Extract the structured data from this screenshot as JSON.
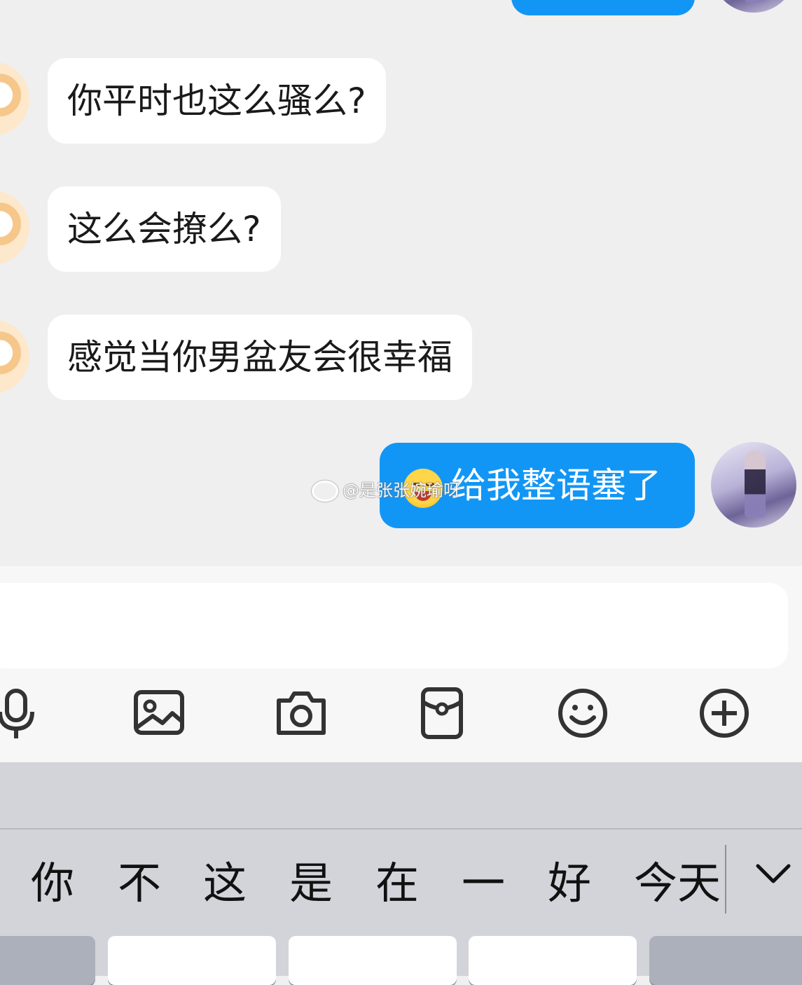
{
  "messages": [
    {
      "side": "in",
      "text": "你平时也这么骚么?"
    },
    {
      "side": "in",
      "text": "这么会撩么?"
    },
    {
      "side": "in",
      "text": "感觉当你男盆友会很幸福"
    },
    {
      "side": "out",
      "text": "给我整语塞了",
      "emoji": "laughing-face-emoji"
    }
  ],
  "watermark": "@是张张婉瑜呀",
  "input": {
    "placeholder": ""
  },
  "toolbar": {
    "icons": [
      "microphone-icon",
      "image-icon",
      "camera-icon",
      "red-packet-icon",
      "emoji-icon",
      "add-icon"
    ]
  },
  "keyboard": {
    "candidates": [
      "你",
      "不",
      "这",
      "是",
      "在",
      "一",
      "好",
      "今天"
    ],
    "expand_icon": "chevron-down-icon"
  },
  "colors": {
    "background": "#efefef",
    "outgoing_bubble": "#1296f5",
    "incoming_bubble": "#ffffff",
    "keyboard": "#d3d4d9"
  }
}
